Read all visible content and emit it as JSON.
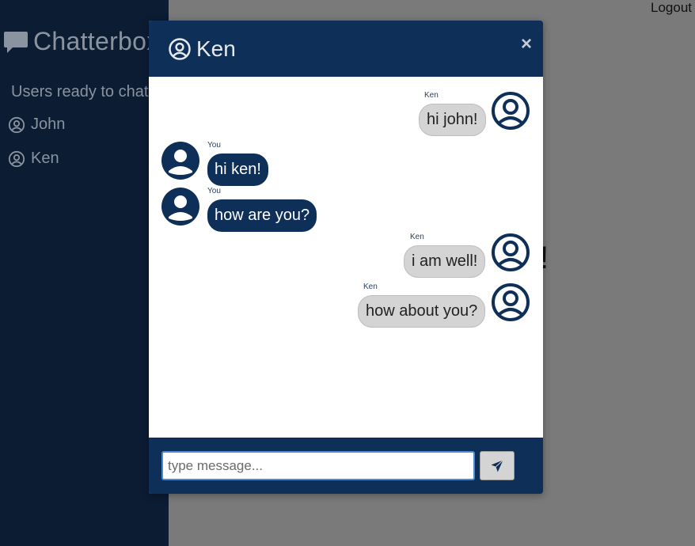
{
  "app": {
    "brand": "Chatterbox"
  },
  "sidebar": {
    "heading": "Users ready to chat",
    "users": [
      {
        "label": "John"
      },
      {
        "label": "Ken"
      }
    ]
  },
  "header": {
    "logout": "Logout"
  },
  "background": {
    "fragment": "!"
  },
  "modal": {
    "title": "Ken",
    "close": "×",
    "messages": [
      {
        "sender": "Ken",
        "text": "hi john!"
      },
      {
        "sender": "You",
        "text": "hi ken!"
      },
      {
        "sender": "You",
        "text": "how are you?"
      },
      {
        "sender": "Ken",
        "text": "i am well!"
      },
      {
        "sender": "Ken",
        "text": "how about you?"
      }
    ],
    "composer": {
      "placeholder": "type message...",
      "value": ""
    }
  },
  "colors": {
    "sidebar": "#0b1c33",
    "header": "#0e2f57",
    "overlay": "#7a7a7a",
    "bubble_mine": "#0e2f57",
    "bubble_theirs": "#d4d4d4"
  },
  "icons": {
    "brand": "chat-bubble-icon",
    "user": "user-circle-icon",
    "send": "paper-plane-icon",
    "close": "close-icon"
  }
}
